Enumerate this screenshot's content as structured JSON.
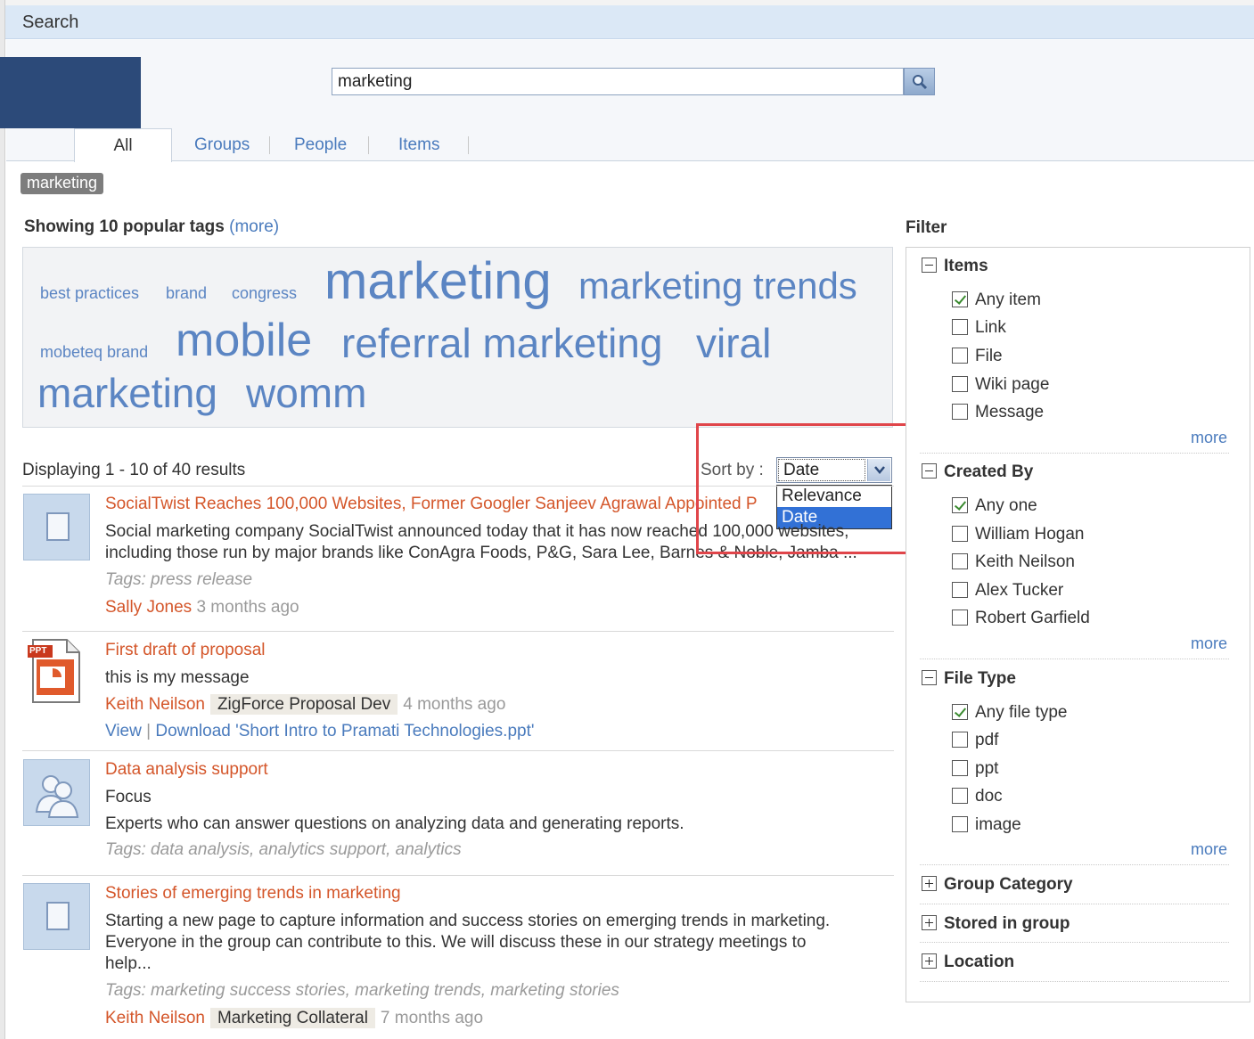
{
  "header": {
    "title": "Search"
  },
  "search": {
    "value": "marketing"
  },
  "tabs": [
    {
      "label": "All"
    },
    {
      "label": "Groups"
    },
    {
      "label": "People"
    },
    {
      "label": "Items"
    }
  ],
  "query_chip": "marketing",
  "popular": {
    "title": "Showing 10 popular tags",
    "more": "(more)",
    "tags": [
      "best practices",
      "brand",
      "congress",
      "marketing",
      "marketing trends",
      "mobeteq brand",
      "mobile",
      "referral marketing",
      "viral",
      "marketing",
      "womm"
    ]
  },
  "results_bar": {
    "count": "Displaying 1 - 10 of 40 results",
    "sort_label": "Sort by :",
    "sort_value": "Date",
    "sort_options": [
      "Relevance",
      "Date"
    ]
  },
  "results": [
    {
      "title": "SocialTwist Reaches 100,000 Websites, Former Googler Sanjeev Agrawal Appointed P",
      "text1": "Social marketing company SocialTwist announced today that it has now reached 100,000 websites,",
      "text2": "including those run by major brands like ConAgra Foods, P&G, Sara Lee, Barnes & Noble, Jamba ...",
      "tags": "Tags: press release",
      "author": "Sally Jones",
      "ago": "3 months ago"
    },
    {
      "title": "First draft of proposal",
      "text1": "this is my message",
      "author": "Keith Neilson",
      "group": "ZigForce Proposal Dev",
      "ago": "4 months ago",
      "view": "View",
      "sep": "|",
      "download": "Download 'Short Intro to Pramati Technologies.ppt'",
      "icon_label": "PPT"
    },
    {
      "title": "Data analysis support",
      "text1": "Focus",
      "text2": "Experts who can answer questions on analyzing data and generating reports.",
      "tags": "Tags: data analysis, analytics support, analytics"
    },
    {
      "title": "Stories of emerging trends in marketing",
      "text1": "Starting a new page to capture information and success stories on emerging trends in marketing.",
      "text2": "Everyone in the group can contribute to this. We will discuss these in our strategy meetings to",
      "text3": "help...",
      "tags": "Tags: marketing success stories, marketing trends, marketing stories",
      "author": "Keith Neilson",
      "group": "Marketing Collateral",
      "ago": "7 months ago"
    }
  ],
  "filter": {
    "title": "Filter",
    "more": "more",
    "items": {
      "title": "Items",
      "options": [
        "Any item",
        "Link",
        "File",
        "Wiki page",
        "Message"
      ]
    },
    "created_by": {
      "title": "Created By",
      "options": [
        "Any one",
        "William Hogan",
        "Keith Neilson",
        "Alex Tucker",
        "Robert Garfield"
      ]
    },
    "file_type": {
      "title": "File Type",
      "options": [
        "Any file type",
        "pdf",
        "ppt",
        "doc",
        "image"
      ]
    },
    "group_category": "Group Category",
    "stored_in_group": "Stored in group",
    "location": "Location"
  },
  "colors": {
    "accent": "#d4562a",
    "link": "#4a7bbd",
    "tag": "#5b85c3",
    "highlight": "#e0454a"
  }
}
